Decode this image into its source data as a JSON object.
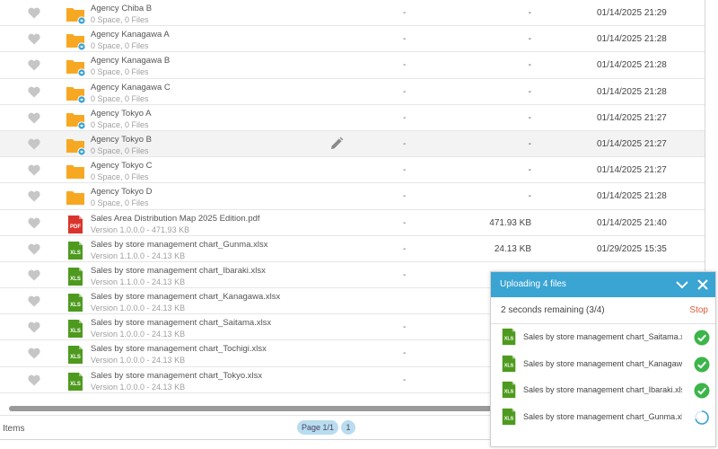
{
  "colors": {
    "folder": "#f7a823",
    "share_badge": "#3aa4d3",
    "pdf": "#d9342b",
    "xls": "#4e9a1f",
    "upload_header": "#3aa4d3",
    "check": "#3cb54a",
    "stop": "#e35a3d",
    "pager": "#b9dcee"
  },
  "files": [
    {
      "name": "Agency Chiba B",
      "sub": "0 Space, 0 Files",
      "type": "folder",
      "shared": true,
      "col1": "-",
      "size": "-",
      "date": "01/14/2025 21:29"
    },
    {
      "name": "Agency Kanagawa A",
      "sub": "0 Space, 0 Files",
      "type": "folder",
      "shared": true,
      "col1": "-",
      "size": "-",
      "date": "01/14/2025 21:28"
    },
    {
      "name": "Agency Kanagawa B",
      "sub": "0 Space, 0 Files",
      "type": "folder",
      "shared": true,
      "col1": "-",
      "size": "-",
      "date": "01/14/2025 21:28"
    },
    {
      "name": "Agency Kanagawa C",
      "sub": "0 Space, 0 Files",
      "type": "folder",
      "shared": true,
      "col1": "-",
      "size": "-",
      "date": "01/14/2025 21:28"
    },
    {
      "name": "Agency Tokyo A",
      "sub": "0 Space, 0 Files",
      "type": "folder",
      "shared": true,
      "col1": "-",
      "size": "-",
      "date": "01/14/2025 21:27"
    },
    {
      "name": "Agency Tokyo B",
      "sub": "0 Space, 0 Files",
      "type": "folder",
      "shared": true,
      "col1": "-",
      "size": "-",
      "date": "01/14/2025 21:27",
      "hover": true
    },
    {
      "name": "Agency Tokyo C",
      "sub": "0 Space, 0 Files",
      "type": "folder",
      "shared": false,
      "col1": "-",
      "size": "-",
      "date": "01/14/2025 21:27"
    },
    {
      "name": "Agency Tokyo D",
      "sub": "0 Space, 0 Files",
      "type": "folder",
      "shared": false,
      "col1": "-",
      "size": "-",
      "date": "01/14/2025 21:28"
    },
    {
      "name": "Sales Area Distribution Map 2025 Edition.pdf",
      "sub": "Version 1.0.0.0 - 471.93 KB",
      "type": "pdf",
      "icon_text": "PDF",
      "col1": "-",
      "size": "471.93 KB",
      "date": "01/14/2025 21:40"
    },
    {
      "name": "Sales by store management chart_Gunma.xlsx",
      "sub": "Version 1.1.0.0 - 24.13 KB",
      "type": "xls",
      "icon_text": "XLS",
      "col1": "-",
      "size": "24.13 KB",
      "date": "01/29/2025 15:35"
    },
    {
      "name": "Sales by store management chart_Ibaraki.xlsx",
      "sub": "Version 1.1.0.0 - 24.13 KB",
      "type": "xls",
      "icon_text": "XLS",
      "col1": "-",
      "size": "",
      "date": ""
    },
    {
      "name": "Sales by store management chart_Kanagawa.xlsx",
      "sub": "Version 1.0.0.0 - 24.13 KB",
      "type": "xls",
      "icon_text": "XLS",
      "col1": "",
      "size": "",
      "date": ""
    },
    {
      "name": "Sales by store management chart_Saitama.xlsx",
      "sub": "Version 1.0.0.0 - 24.13 KB",
      "type": "xls",
      "icon_text": "XLS",
      "col1": "-",
      "size": "",
      "date": ""
    },
    {
      "name": "Sales by store management chart_Tochigi.xlsx",
      "sub": "Version 1.0.0.0 - 24.13 KB",
      "type": "xls",
      "icon_text": "XLS",
      "col1": "-",
      "size": "",
      "date": ""
    },
    {
      "name": "Sales by store management chart_Tokyo.xlsx",
      "sub": "Version 1.0.0.0 - 24.13 KB",
      "type": "xls",
      "icon_text": "XLS",
      "col1": "-",
      "size": "",
      "date": ""
    }
  ],
  "footer": {
    "items_label": "Items",
    "page_label": "Page 1/1",
    "page_number": "1"
  },
  "upload": {
    "title": "Uploading 4 files",
    "remaining": "2 seconds remaining (3/4)",
    "stop_label": "Stop",
    "icon_text": "XLS",
    "items": [
      {
        "name": "Sales by store management chart_Saitama.xlsx",
        "status": "done"
      },
      {
        "name": "Sales by store management chart_Kanagawa.xlsx",
        "status": "done"
      },
      {
        "name": "Sales by store management chart_Ibaraki.xlsx",
        "status": "done"
      },
      {
        "name": "Sales by store management chart_Gunma.xlsx",
        "status": "uploading"
      }
    ]
  }
}
